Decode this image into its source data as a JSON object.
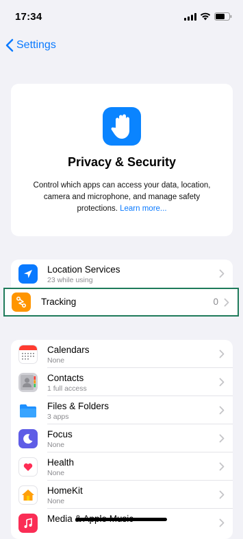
{
  "status": {
    "time": "17:34"
  },
  "nav": {
    "back_label": "Settings"
  },
  "hero": {
    "title": "Privacy & Security",
    "description": "Control which apps can access your data, location, camera and microphone, and manage safety protections.",
    "link": "Learn more..."
  },
  "group1": {
    "location": {
      "title": "Location Services",
      "subtitle": "23 while using"
    },
    "tracking": {
      "title": "Tracking",
      "value": "0"
    }
  },
  "group2": {
    "items": [
      {
        "title": "Calendars",
        "subtitle": "None",
        "icon": "calendar-icon"
      },
      {
        "title": "Contacts",
        "subtitle": "1 full access",
        "icon": "contacts-icon"
      },
      {
        "title": "Files & Folders",
        "subtitle": "3 apps",
        "icon": "folder-icon"
      },
      {
        "title": "Focus",
        "subtitle": "None",
        "icon": "moon-icon"
      },
      {
        "title": "Health",
        "subtitle": "None",
        "icon": "heart-icon"
      },
      {
        "title": "HomeKit",
        "subtitle": "None",
        "icon": "home-icon"
      },
      {
        "title": "Media & Apple Music",
        "subtitle": "",
        "icon": "music-icon"
      }
    ]
  },
  "colors": {
    "accent": "#0a7aff",
    "tracking_highlight": "#1e7a5a",
    "tracking_icon": "#ff9500"
  }
}
